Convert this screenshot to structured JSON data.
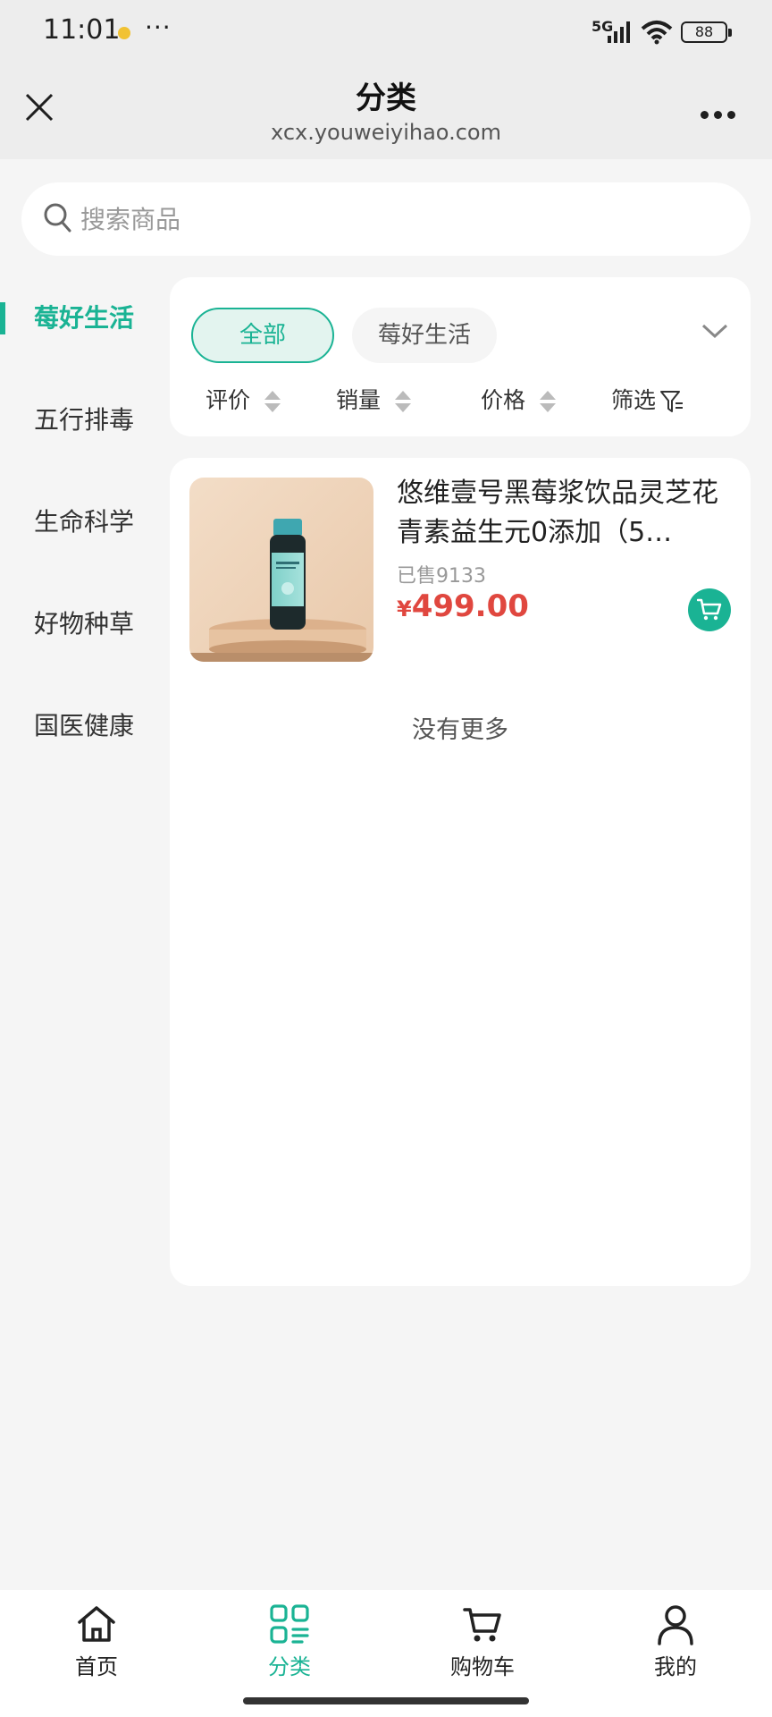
{
  "status_bar": {
    "time": "11:01",
    "network": "5G",
    "battery": "88"
  },
  "nav": {
    "title": "分类",
    "url": "xcx.youweiyihao.com"
  },
  "search": {
    "placeholder": "搜索商品"
  },
  "sidebar": {
    "active_index": 0,
    "items": [
      {
        "label": "莓好生活"
      },
      {
        "label": "五行排毒"
      },
      {
        "label": "生命科学"
      },
      {
        "label": "好物种草"
      },
      {
        "label": "国医健康"
      }
    ]
  },
  "filters": {
    "chips": [
      {
        "label": "全部"
      },
      {
        "label": "莓好生活"
      }
    ],
    "sort": {
      "rating": "评价",
      "sales": "销量",
      "price": "价格",
      "filter": "筛选"
    }
  },
  "products": [
    {
      "title": "悠维壹号黑莓浆饮品灵芝花青素益生元0添加（5…",
      "sold": "已售9133",
      "price_symbol": "¥",
      "price": "499.00"
    }
  ],
  "list": {
    "no_more": "没有更多"
  },
  "tab_bar": {
    "items": [
      {
        "label": "首页"
      },
      {
        "label": "分类"
      },
      {
        "label": "购物车"
      },
      {
        "label": "我的"
      }
    ],
    "active_index": 1
  },
  "colors": {
    "accent": "#1ab394",
    "price": "#e0473f",
    "background": "#f5f5f5"
  }
}
